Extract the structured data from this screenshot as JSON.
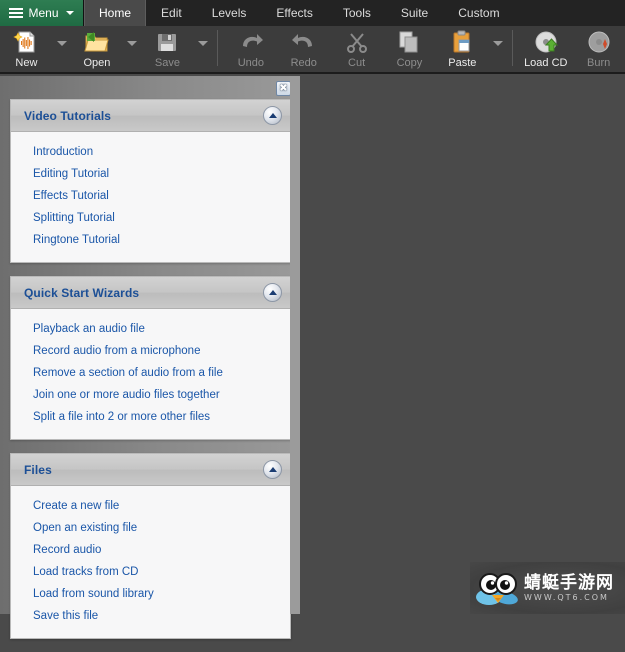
{
  "menubar": {
    "menu_button": {
      "label": "Menu",
      "icon": "hamburger-icon",
      "caret": "chevron-down-icon",
      "color": "#2e7d52"
    },
    "tabs": [
      {
        "label": "Home",
        "active": true
      },
      {
        "label": "Edit",
        "active": false
      },
      {
        "label": "Levels",
        "active": false
      },
      {
        "label": "Effects",
        "active": false
      },
      {
        "label": "Tools",
        "active": false
      },
      {
        "label": "Suite",
        "active": false
      },
      {
        "label": "Custom",
        "active": false
      }
    ]
  },
  "ribbon": {
    "buttons": [
      {
        "label": "New",
        "icon": "new-document-waveform-icon",
        "enabled": true,
        "has_dropdown": true
      },
      {
        "label": "Open",
        "icon": "open-folder-icon",
        "enabled": true,
        "has_dropdown": true
      },
      {
        "label": "Save",
        "icon": "floppy-disk-icon",
        "enabled": false,
        "has_dropdown": true
      },
      {
        "label": "Undo",
        "icon": "undo-arrow-icon",
        "enabled": false,
        "has_dropdown": false
      },
      {
        "label": "Redo",
        "icon": "redo-arrow-icon",
        "enabled": false,
        "has_dropdown": false
      },
      {
        "label": "Cut",
        "icon": "scissors-icon",
        "enabled": false,
        "has_dropdown": false
      },
      {
        "label": "Copy",
        "icon": "copy-pages-icon",
        "enabled": false,
        "has_dropdown": false
      },
      {
        "label": "Paste",
        "icon": "clipboard-icon",
        "enabled": true,
        "has_dropdown": true
      },
      {
        "label": "Load CD",
        "icon": "cd-up-arrow-icon",
        "enabled": true,
        "has_dropdown": false
      },
      {
        "label": "Burn",
        "icon": "cd-burn-icon",
        "enabled": false,
        "has_dropdown": false
      }
    ]
  },
  "panel": {
    "close_label": "✖",
    "close_icon": "close-icon",
    "collapse_icon": "collapse-up-icon",
    "link_color": "#1a56a8",
    "sections": [
      {
        "title": "Video Tutorials",
        "links": [
          "Introduction",
          "Editing Tutorial",
          "Effects Tutorial",
          "Splitting Tutorial",
          "Ringtone Tutorial"
        ]
      },
      {
        "title": "Quick Start Wizards",
        "links": [
          "Playback an audio file",
          "Record audio from a microphone",
          "Remove a section of audio from a file",
          "Join one or more audio files together",
          "Split a file into 2 or more other files"
        ]
      },
      {
        "title": "Files",
        "links": [
          "Create a new file",
          "Open an existing file",
          "Record audio",
          "Load tracks from CD",
          "Load from sound library",
          "Save this file"
        ]
      }
    ]
  },
  "watermark": {
    "cn_text": "蜻蜓手游网",
    "url_text": "WWW.QT6.COM",
    "icon": "bird-mascot-icon"
  }
}
